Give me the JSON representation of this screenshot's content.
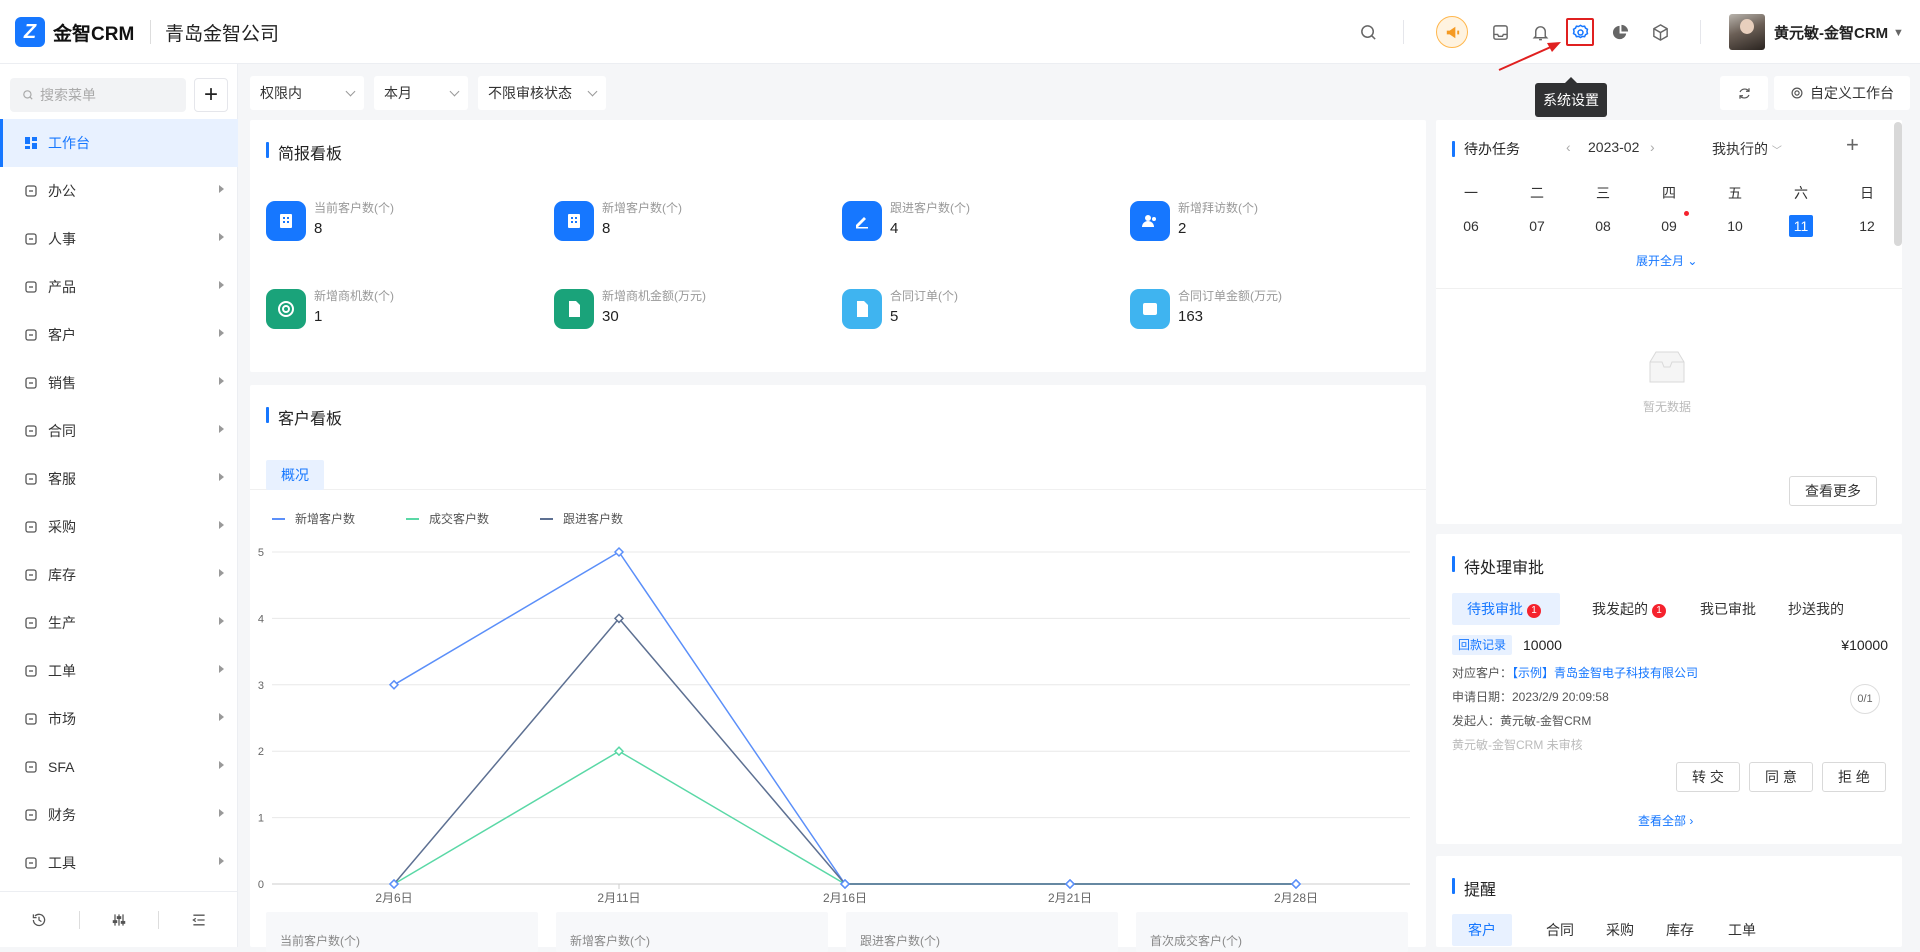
{
  "brand": {
    "logo_letter": "Z",
    "name": "金智CRM",
    "company": "青岛金智公司"
  },
  "toolbar": {
    "icons": [
      "search-icon",
      "announcement-icon",
      "inbox-icon",
      "bell-icon",
      "settings-icon",
      "pie-chart-icon",
      "cube-icon"
    ],
    "settings_tooltip": "系统设置",
    "user_name": "黄元敏-金智CRM"
  },
  "sidebar": {
    "search_placeholder": "搜索菜单",
    "add_label": "+",
    "items": [
      {
        "label": "工作台",
        "icon": "dashboard-icon",
        "active": true
      },
      {
        "label": "办公",
        "icon": "monitor-icon"
      },
      {
        "label": "人事",
        "icon": "people-icon"
      },
      {
        "label": "产品",
        "icon": "box-icon"
      },
      {
        "label": "客户",
        "icon": "building-icon"
      },
      {
        "label": "销售",
        "icon": "target-icon"
      },
      {
        "label": "合同",
        "icon": "document-icon"
      },
      {
        "label": "客服",
        "icon": "headset-icon"
      },
      {
        "label": "采购",
        "icon": "bag-icon"
      },
      {
        "label": "库存",
        "icon": "warehouse-icon"
      },
      {
        "label": "生产",
        "icon": "factory-icon"
      },
      {
        "label": "工单",
        "icon": "ticket-icon"
      },
      {
        "label": "市场",
        "icon": "store-icon"
      },
      {
        "label": "SFA",
        "icon": "sfa-icon"
      },
      {
        "label": "财务",
        "icon": "bank-icon"
      },
      {
        "label": "工具",
        "icon": "toolbox-icon"
      }
    ],
    "footer_icons": [
      "history-icon",
      "sliders-icon",
      "collapse-icon"
    ]
  },
  "filters": {
    "scope": "权限内",
    "period": "本月",
    "audit": "不限审核状态",
    "custom_workspace": "自定义工作台"
  },
  "brief": {
    "title": "简报看板",
    "stats": [
      {
        "label": "当前客户数(个)",
        "value": "8",
        "color": "#1677ff",
        "icon": "building-icon"
      },
      {
        "label": "新增客户数(个)",
        "value": "8",
        "color": "#1677ff",
        "icon": "building-icon"
      },
      {
        "label": "跟进客户数(个)",
        "value": "4",
        "color": "#1677ff",
        "icon": "pen-icon"
      },
      {
        "label": "新增拜访数(个)",
        "value": "2",
        "color": "#1677ff",
        "icon": "people-icon"
      },
      {
        "label": "新增商机数(个)",
        "value": "1",
        "color": "#1aa37a",
        "icon": "target-icon"
      },
      {
        "label": "新增商机金额(万元)",
        "value": "30",
        "color": "#1aa37a",
        "icon": "document-icon"
      },
      {
        "label": "合同订单(个)",
        "value": "5",
        "color": "#3fb4f0",
        "icon": "document-icon"
      },
      {
        "label": "合同订单金额(万元)",
        "value": "163",
        "color": "#3fb4f0",
        "icon": "money-icon"
      }
    ]
  },
  "customer": {
    "title": "客户看板",
    "tab": "概况",
    "mini_cards": [
      "当前客户数(个)",
      "新增客户数(个)",
      "跟进客户数(个)",
      "首次成交客户(个)"
    ]
  },
  "chart_data": {
    "type": "line",
    "categories": [
      "2月6日",
      "2月11日",
      "2月16日",
      "2月21日",
      "2月28日"
    ],
    "series": [
      {
        "name": "新增客户数",
        "color": "#5b8ff9",
        "values": [
          3,
          5,
          0,
          0,
          0
        ]
      },
      {
        "name": "成交客户数",
        "color": "#5ad8a6",
        "values": [
          0,
          2,
          0,
          0,
          0
        ]
      },
      {
        "name": "跟进客户数",
        "color": "#5d7092",
        "values": [
          0,
          4,
          0,
          0,
          0
        ]
      }
    ],
    "ylim": [
      0,
      5
    ],
    "yticks": [
      "0",
      "1",
      "2",
      "3",
      "4",
      "5"
    ],
    "grid": true,
    "legend": "top-left"
  },
  "todo": {
    "title": "待办任务",
    "month": "2023-02",
    "scope": "我执行的",
    "weekdays": [
      "一",
      "二",
      "三",
      "四",
      "五",
      "六",
      "日"
    ],
    "days": [
      "06",
      "07",
      "08",
      "09",
      "10",
      "11",
      "12"
    ],
    "selected_day": "11",
    "dot_day": "09",
    "expand": "展开全月",
    "empty": "暂无数据",
    "more": "查看更多"
  },
  "approval": {
    "title": "待处理审批",
    "tabs": [
      {
        "label": "待我审批",
        "badge": "1"
      },
      {
        "label": "我发起的",
        "badge": "1"
      },
      {
        "label": "我已审批"
      },
      {
        "label": "抄送我的"
      }
    ],
    "item": {
      "tag": "回款记录",
      "amount_left": "10000",
      "amount_right": "¥10000",
      "customer_label": "对应客户：",
      "customer": "【示例】青岛金智电子科技有限公司",
      "date": "申请日期：2023/2/9 20:09:58",
      "initiator": "发起人：黄元敏-金智CRM",
      "status": "黄元敏-金智CRM 未审核",
      "counter": "0/1"
    },
    "buttons": [
      "转 交",
      "同 意",
      "拒 绝"
    ],
    "view_all": "查看全部"
  },
  "reminder": {
    "title": "提醒",
    "tabs": [
      "客户",
      "合同",
      "采购",
      "库存",
      "工单"
    ]
  }
}
